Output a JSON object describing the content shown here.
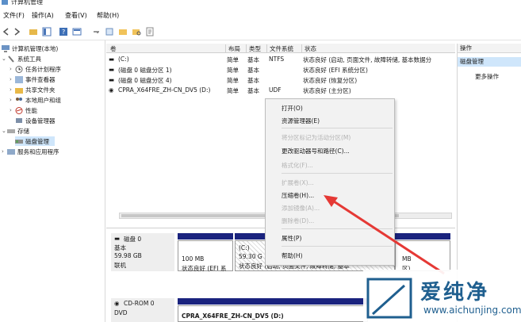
{
  "window": {
    "title": "计算机管理"
  },
  "menu": {
    "items": [
      "文件(F)",
      "操作(A)",
      "查看(V)",
      "帮助(H)"
    ]
  },
  "tree": {
    "root": "计算机管理(本地)",
    "system_tools": "系统工具",
    "task_scheduler": "任务计划程序",
    "event_viewer": "事件查看器",
    "shared_folders": "共享文件夹",
    "local_users": "本地用户和组",
    "performance": "性能",
    "device_manager": "设备管理器",
    "storage": "存储",
    "disk_management": "磁盘管理",
    "services": "服务和应用程序"
  },
  "volume_table": {
    "headers": [
      "卷",
      "布局",
      "类型",
      "文件系统",
      "状态"
    ],
    "rows": [
      [
        "(C:)",
        "简单",
        "基本",
        "NTFS",
        "状态良好 (启动, 页面文件, 故障转储, 基本数据分"
      ],
      [
        "(磁盘 0 磁盘分区 1)",
        "简单",
        "基本",
        "",
        "状态良好 (EFI 系统分区)"
      ],
      [
        "(磁盘 0 磁盘分区 4)",
        "简单",
        "基本",
        "",
        "状态良好 (恢复分区)"
      ],
      [
        "CPRA_X64FRE_ZH-CN_DV5 (D:)",
        "简单",
        "基本",
        "UDF",
        "状态良好 (主分区)"
      ]
    ]
  },
  "disks": {
    "disk0": {
      "name": "磁盘 0",
      "type": "基本",
      "size": "59.98 GB",
      "status": "联机"
    },
    "p1": {
      "size": "100 MB",
      "status": "状态良好 (EFI 系"
    },
    "c": {
      "name": "(C:)",
      "size": "59.30 G",
      "status": "状态良好 (启动, 页面文件, 故障转储, 基本"
    },
    "p4": {
      "size": "MB",
      "status": "区)"
    },
    "cdrom": {
      "name": "CD-ROM 0",
      "type": "DVD",
      "volume": "CPRA_X64FRE_ZH-CN_DV5 (D:)"
    }
  },
  "actions": {
    "header": "操作",
    "selected": "磁盘管理",
    "more": "更多操作"
  },
  "context_menu": {
    "open": "打开(O)",
    "explorer": "资源管理器(E)",
    "mark_active": "将分区标记为活动分区(M)",
    "change_letter": "更改驱动器号和路径(C)...",
    "format": "格式化(F)...",
    "extend": "扩展卷(X)...",
    "shrink": "压缩卷(H)...",
    "add_mirror": "添加镜像(A)...",
    "delete": "删除卷(D)...",
    "properties": "属性(P)",
    "help": "帮助(H)"
  },
  "watermark": {
    "cn": "爱纯净",
    "en": "www.aichunjing.com"
  },
  "colors": {
    "accent": "#1a237e",
    "selection": "#cfe6fb",
    "arrow": "#e53935",
    "watermark": "#1f5f8f"
  }
}
